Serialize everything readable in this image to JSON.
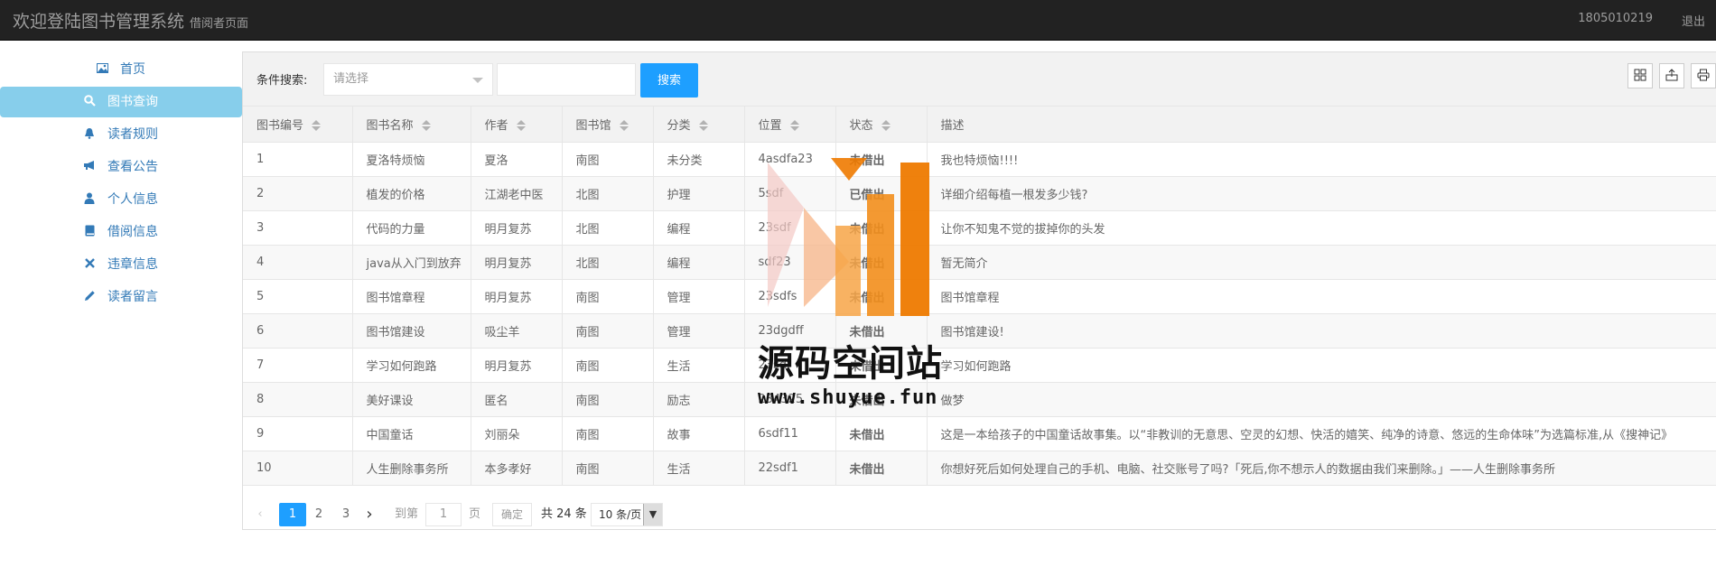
{
  "header": {
    "title": "欢迎登陆图书管理系统",
    "subtitle": "借阅者页面",
    "user_id": "1805010219",
    "logout_label": "退出"
  },
  "sidebar": {
    "items": [
      {
        "label": "首页",
        "icon": "picture-icon"
      },
      {
        "label": "图书查询",
        "icon": "search-icon"
      },
      {
        "label": "读者规则",
        "icon": "bell-icon"
      },
      {
        "label": "查看公告",
        "icon": "bullhorn-icon"
      },
      {
        "label": "个人信息",
        "icon": "user-icon"
      },
      {
        "label": "借阅信息",
        "icon": "book-icon"
      },
      {
        "label": "违章信息",
        "icon": "remove-icon"
      },
      {
        "label": "读者留言",
        "icon": "pencil-icon"
      }
    ],
    "active_index": 1
  },
  "search": {
    "label": "条件搜索:",
    "select_placeholder": "请选择",
    "input_value": "",
    "button_label": "搜索"
  },
  "table": {
    "headers": [
      "图书编号",
      "图书名称",
      "作者",
      "图书馆",
      "分类",
      "位置",
      "状态",
      "描述"
    ],
    "rows": [
      [
        "1",
        "夏洛特烦恼",
        "夏洛",
        "南图",
        "未分类",
        "4asdfa23",
        "未借出",
        "我也特烦恼!!!!"
      ],
      [
        "2",
        "植发的价格",
        "江湖老中医",
        "北图",
        "护理",
        "5sdf",
        "已借出",
        "详细介绍每植一根发多少钱?"
      ],
      [
        "3",
        "代码的力量",
        "明月复苏",
        "北图",
        "编程",
        "23sdf",
        "未借出",
        "让你不知鬼不觉的拔掉你的头发"
      ],
      [
        "4",
        "java从入门到放弃",
        "明月复苏",
        "北图",
        "编程",
        "sdf23",
        "未借出",
        "暂无简介"
      ],
      [
        "5",
        "图书馆章程",
        "明月复苏",
        "南图",
        "管理",
        "23sdfs",
        "未借出",
        "图书馆章程"
      ],
      [
        "6",
        "图书馆建设",
        "吸尘羊",
        "南图",
        "管理",
        "23dgdff",
        "未借出",
        "图书馆建设!"
      ],
      [
        "7",
        "学习如何跑路",
        "明月复苏",
        "南图",
        "生活",
        "23sdf",
        "未借出",
        "学习如何跑路"
      ],
      [
        "8",
        "美好课设",
        "匿名",
        "南图",
        "励志",
        "234325",
        "未借出",
        "做梦"
      ],
      [
        "9",
        "中国童话",
        "刘丽朵",
        "南图",
        "故事",
        "6sdf11",
        "未借出",
        "这是一本给孩子的中国童话故事集。以“非教训的无意思、空灵的幻想、快活的嬉笑、纯净的诗意、悠远的生命体味”为选篇标准,从《搜神记》"
      ],
      [
        "10",
        "人生删除事务所",
        "本多孝好",
        "南图",
        "生活",
        "22sdf1",
        "未借出",
        "你想好死后如何处理自己的手机、电脑、社交账号了吗?「死后,你不想示人的数据由我们来删除。」——人生删除事务所"
      ]
    ]
  },
  "pagination": {
    "pages": [
      "1",
      "2",
      "3"
    ],
    "current": "1",
    "goto_label": "到第",
    "goto_value": "1",
    "page_unit": "页",
    "confirm_label": "确定",
    "total_label": "共 24 条",
    "page_size": "10 条/页"
  },
  "watermark": {
    "text": "源码空间站",
    "url": "www.shuyue.fun"
  },
  "colors": {
    "topbar": "#222222",
    "active_nav": "#87ceeb",
    "link": "#337ab7",
    "primary": "#1e9fff",
    "status_in": "#009688",
    "status_out": "#ffb800"
  }
}
